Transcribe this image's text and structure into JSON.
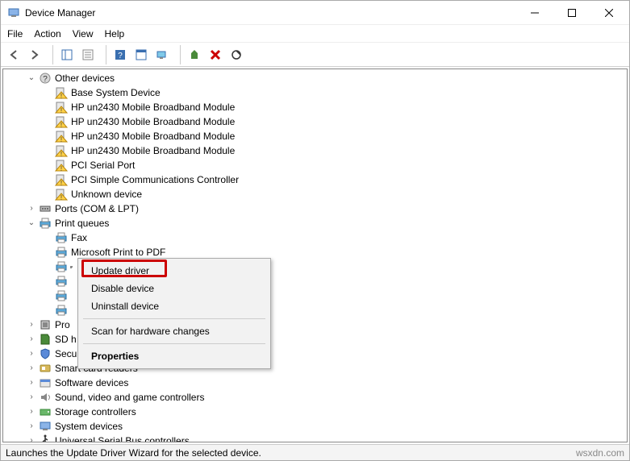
{
  "window": {
    "title": "Device Manager"
  },
  "menu": {
    "file": "File",
    "action": "Action",
    "view": "View",
    "help": "Help"
  },
  "tree": {
    "nodes": [
      {
        "depth": 1,
        "toggle": "expanded",
        "icon": "unknown-category-icon",
        "label": "Other devices"
      },
      {
        "depth": 2,
        "toggle": "none",
        "icon": "warn-device-icon",
        "label": "Base System Device"
      },
      {
        "depth": 2,
        "toggle": "none",
        "icon": "warn-device-icon",
        "label": "HP un2430 Mobile Broadband Module"
      },
      {
        "depth": 2,
        "toggle": "none",
        "icon": "warn-device-icon",
        "label": "HP un2430 Mobile Broadband Module"
      },
      {
        "depth": 2,
        "toggle": "none",
        "icon": "warn-device-icon",
        "label": "HP un2430 Mobile Broadband Module"
      },
      {
        "depth": 2,
        "toggle": "none",
        "icon": "warn-device-icon",
        "label": "HP un2430 Mobile Broadband Module"
      },
      {
        "depth": 2,
        "toggle": "none",
        "icon": "warn-device-icon",
        "label": "PCI Serial Port"
      },
      {
        "depth": 2,
        "toggle": "none",
        "icon": "warn-device-icon",
        "label": "PCI Simple Communications Controller"
      },
      {
        "depth": 2,
        "toggle": "none",
        "icon": "warn-device-icon",
        "label": "Unknown device"
      },
      {
        "depth": 1,
        "toggle": "collapsed",
        "icon": "port-icon",
        "label": "Ports (COM & LPT)"
      },
      {
        "depth": 1,
        "toggle": "expanded",
        "icon": "printer-icon",
        "label": "Print queues"
      },
      {
        "depth": 2,
        "toggle": "none",
        "icon": "printer-icon",
        "label": "Fax"
      },
      {
        "depth": 2,
        "toggle": "none",
        "icon": "printer-icon",
        "label": "Microsoft Print to PDF"
      },
      {
        "depth": 2,
        "toggle": "none",
        "icon": "printer-icon",
        "label": "",
        "selected": true
      },
      {
        "depth": 2,
        "toggle": "none",
        "icon": "printer-icon",
        "label": ""
      },
      {
        "depth": 2,
        "toggle": "none",
        "icon": "printer-icon",
        "label": ""
      },
      {
        "depth": 2,
        "toggle": "none",
        "icon": "printer-icon",
        "label": ""
      },
      {
        "depth": 1,
        "toggle": "collapsed",
        "icon": "processor-icon",
        "label": "Pro"
      },
      {
        "depth": 1,
        "toggle": "collapsed",
        "icon": "sd-icon",
        "label": "SD h"
      },
      {
        "depth": 1,
        "toggle": "collapsed",
        "icon": "security-icon",
        "label": "Secu"
      },
      {
        "depth": 1,
        "toggle": "collapsed",
        "icon": "smartcard-icon",
        "label": "Smart card readers"
      },
      {
        "depth": 1,
        "toggle": "collapsed",
        "icon": "software-icon",
        "label": "Software devices"
      },
      {
        "depth": 1,
        "toggle": "collapsed",
        "icon": "sound-icon",
        "label": "Sound, video and game controllers"
      },
      {
        "depth": 1,
        "toggle": "collapsed",
        "icon": "storage-icon",
        "label": "Storage controllers"
      },
      {
        "depth": 1,
        "toggle": "collapsed",
        "icon": "system-icon",
        "label": "System devices"
      },
      {
        "depth": 1,
        "toggle": "collapsed",
        "icon": "usb-icon",
        "label": "Universal Serial Bus controllers"
      }
    ]
  },
  "context_menu": {
    "update": "Update driver",
    "disable": "Disable device",
    "uninstall": "Uninstall device",
    "scan": "Scan for hardware changes",
    "properties": "Properties"
  },
  "status": {
    "text": "Launches the Update Driver Wizard for the selected device.",
    "watermark": "wsxdn.com"
  }
}
